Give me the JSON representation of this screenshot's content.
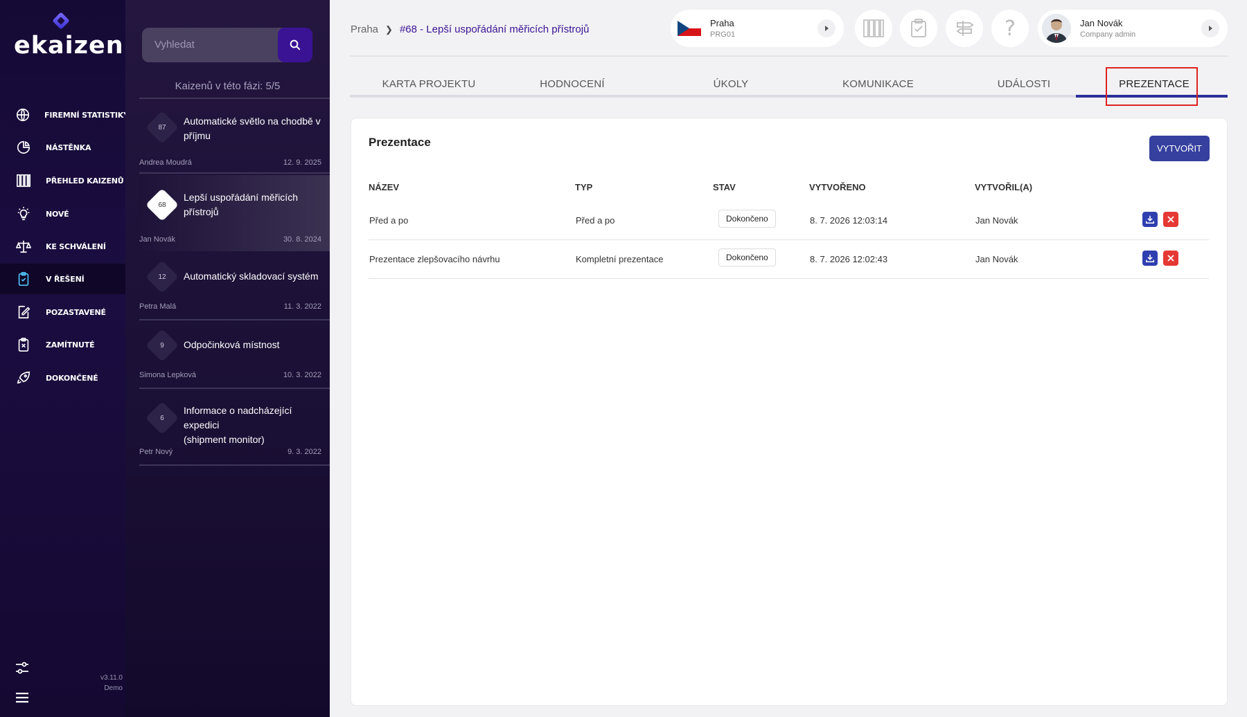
{
  "app": {
    "brand": "ekaizen",
    "version": "v3.11.0",
    "environment": "Demo"
  },
  "nav": {
    "items": [
      {
        "label": "FIREMNÍ STATISTIKY",
        "icon": "globe-icon"
      },
      {
        "label": "NÁSTĚNKA",
        "icon": "pie-chart-icon"
      },
      {
        "label": "PŘEHLED KAIZENŮ",
        "icon": "columns-icon"
      },
      {
        "label": "NOVÉ",
        "icon": "lightbulb-icon"
      },
      {
        "label": "KE SCHVÁLENÍ",
        "icon": "scales-icon"
      },
      {
        "label": "V ŘEŠENÍ",
        "icon": "clipboard-progress-icon",
        "active": true
      },
      {
        "label": "POZASTAVENÉ",
        "icon": "pause-doc-icon"
      },
      {
        "label": "ZAMÍTNUTÉ",
        "icon": "clipboard-x-icon"
      },
      {
        "label": "DOKONČENÉ",
        "icon": "rocket-icon"
      }
    ]
  },
  "list": {
    "search_placeholder": "Vyhledat",
    "phase_count": "Kaizenů v této fázi: 5/5",
    "items": [
      {
        "number": "87",
        "title_line1": "Automatické světlo na chodbě v",
        "title_line2": "příjmu",
        "author": "Andrea Moudrá",
        "date": "12. 9. 2025"
      },
      {
        "number": "68",
        "title_line1": "Lepší uspořádání měřicích",
        "title_line2": "přístrojů",
        "author": "Jan Novák",
        "date": "30. 8. 2024",
        "active": true
      },
      {
        "number": "12",
        "title_line1": "Automatický skladovací systém",
        "title_line2": "",
        "author": "Petra Malá",
        "date": "11. 3. 2022"
      },
      {
        "number": "9",
        "title_line1": "Odpočinková místnost",
        "title_line2": "",
        "author": "Simona Lepková",
        "date": "10. 3. 2022"
      },
      {
        "number": "6",
        "title_line1": "Informace o nadcházející expedici",
        "title_line2": "(shipment monitor)",
        "author": "Petr Nový",
        "date": "9. 3. 2022"
      }
    ]
  },
  "header": {
    "breadcrumb_home": "Praha",
    "breadcrumb_current": "#68 - Lepší uspořádání měřicích přístrojů",
    "location_name": "Praha",
    "location_code": "PRG01",
    "user_name": "Jan Novák",
    "user_role": "Company admin"
  },
  "tabs": [
    {
      "label": "KARTA PROJEKTU"
    },
    {
      "label": "HODNOCENÍ"
    },
    {
      "label": "ÚKOLY"
    },
    {
      "label": "KOMUNIKACE"
    },
    {
      "label": "UDÁLOSTI"
    },
    {
      "label": "PREZENTACE",
      "active": true
    }
  ],
  "card": {
    "title": "Prezentace",
    "create_label": "VYTVOŘIT",
    "columns": [
      "NÁZEV",
      "TYP",
      "STAV",
      "VYTVOŘENO",
      "VYTVOŘIL(A)"
    ],
    "rows": [
      {
        "name": "Před a po",
        "type": "Před a po",
        "status": "Dokončeno",
        "created": "8. 7. 2026 12:03:14",
        "author": "Jan Novák"
      },
      {
        "name": "Prezentace zlepšovacího návrhu",
        "type": "Kompletní prezentace",
        "status": "Dokončeno",
        "created": "8. 7. 2026 12:02:43",
        "author": "Jan Novák"
      }
    ]
  },
  "colors": {
    "accent": "#35409f",
    "sidebar": "#150a36",
    "delete": "#e53935",
    "highlight": "#e02020"
  }
}
